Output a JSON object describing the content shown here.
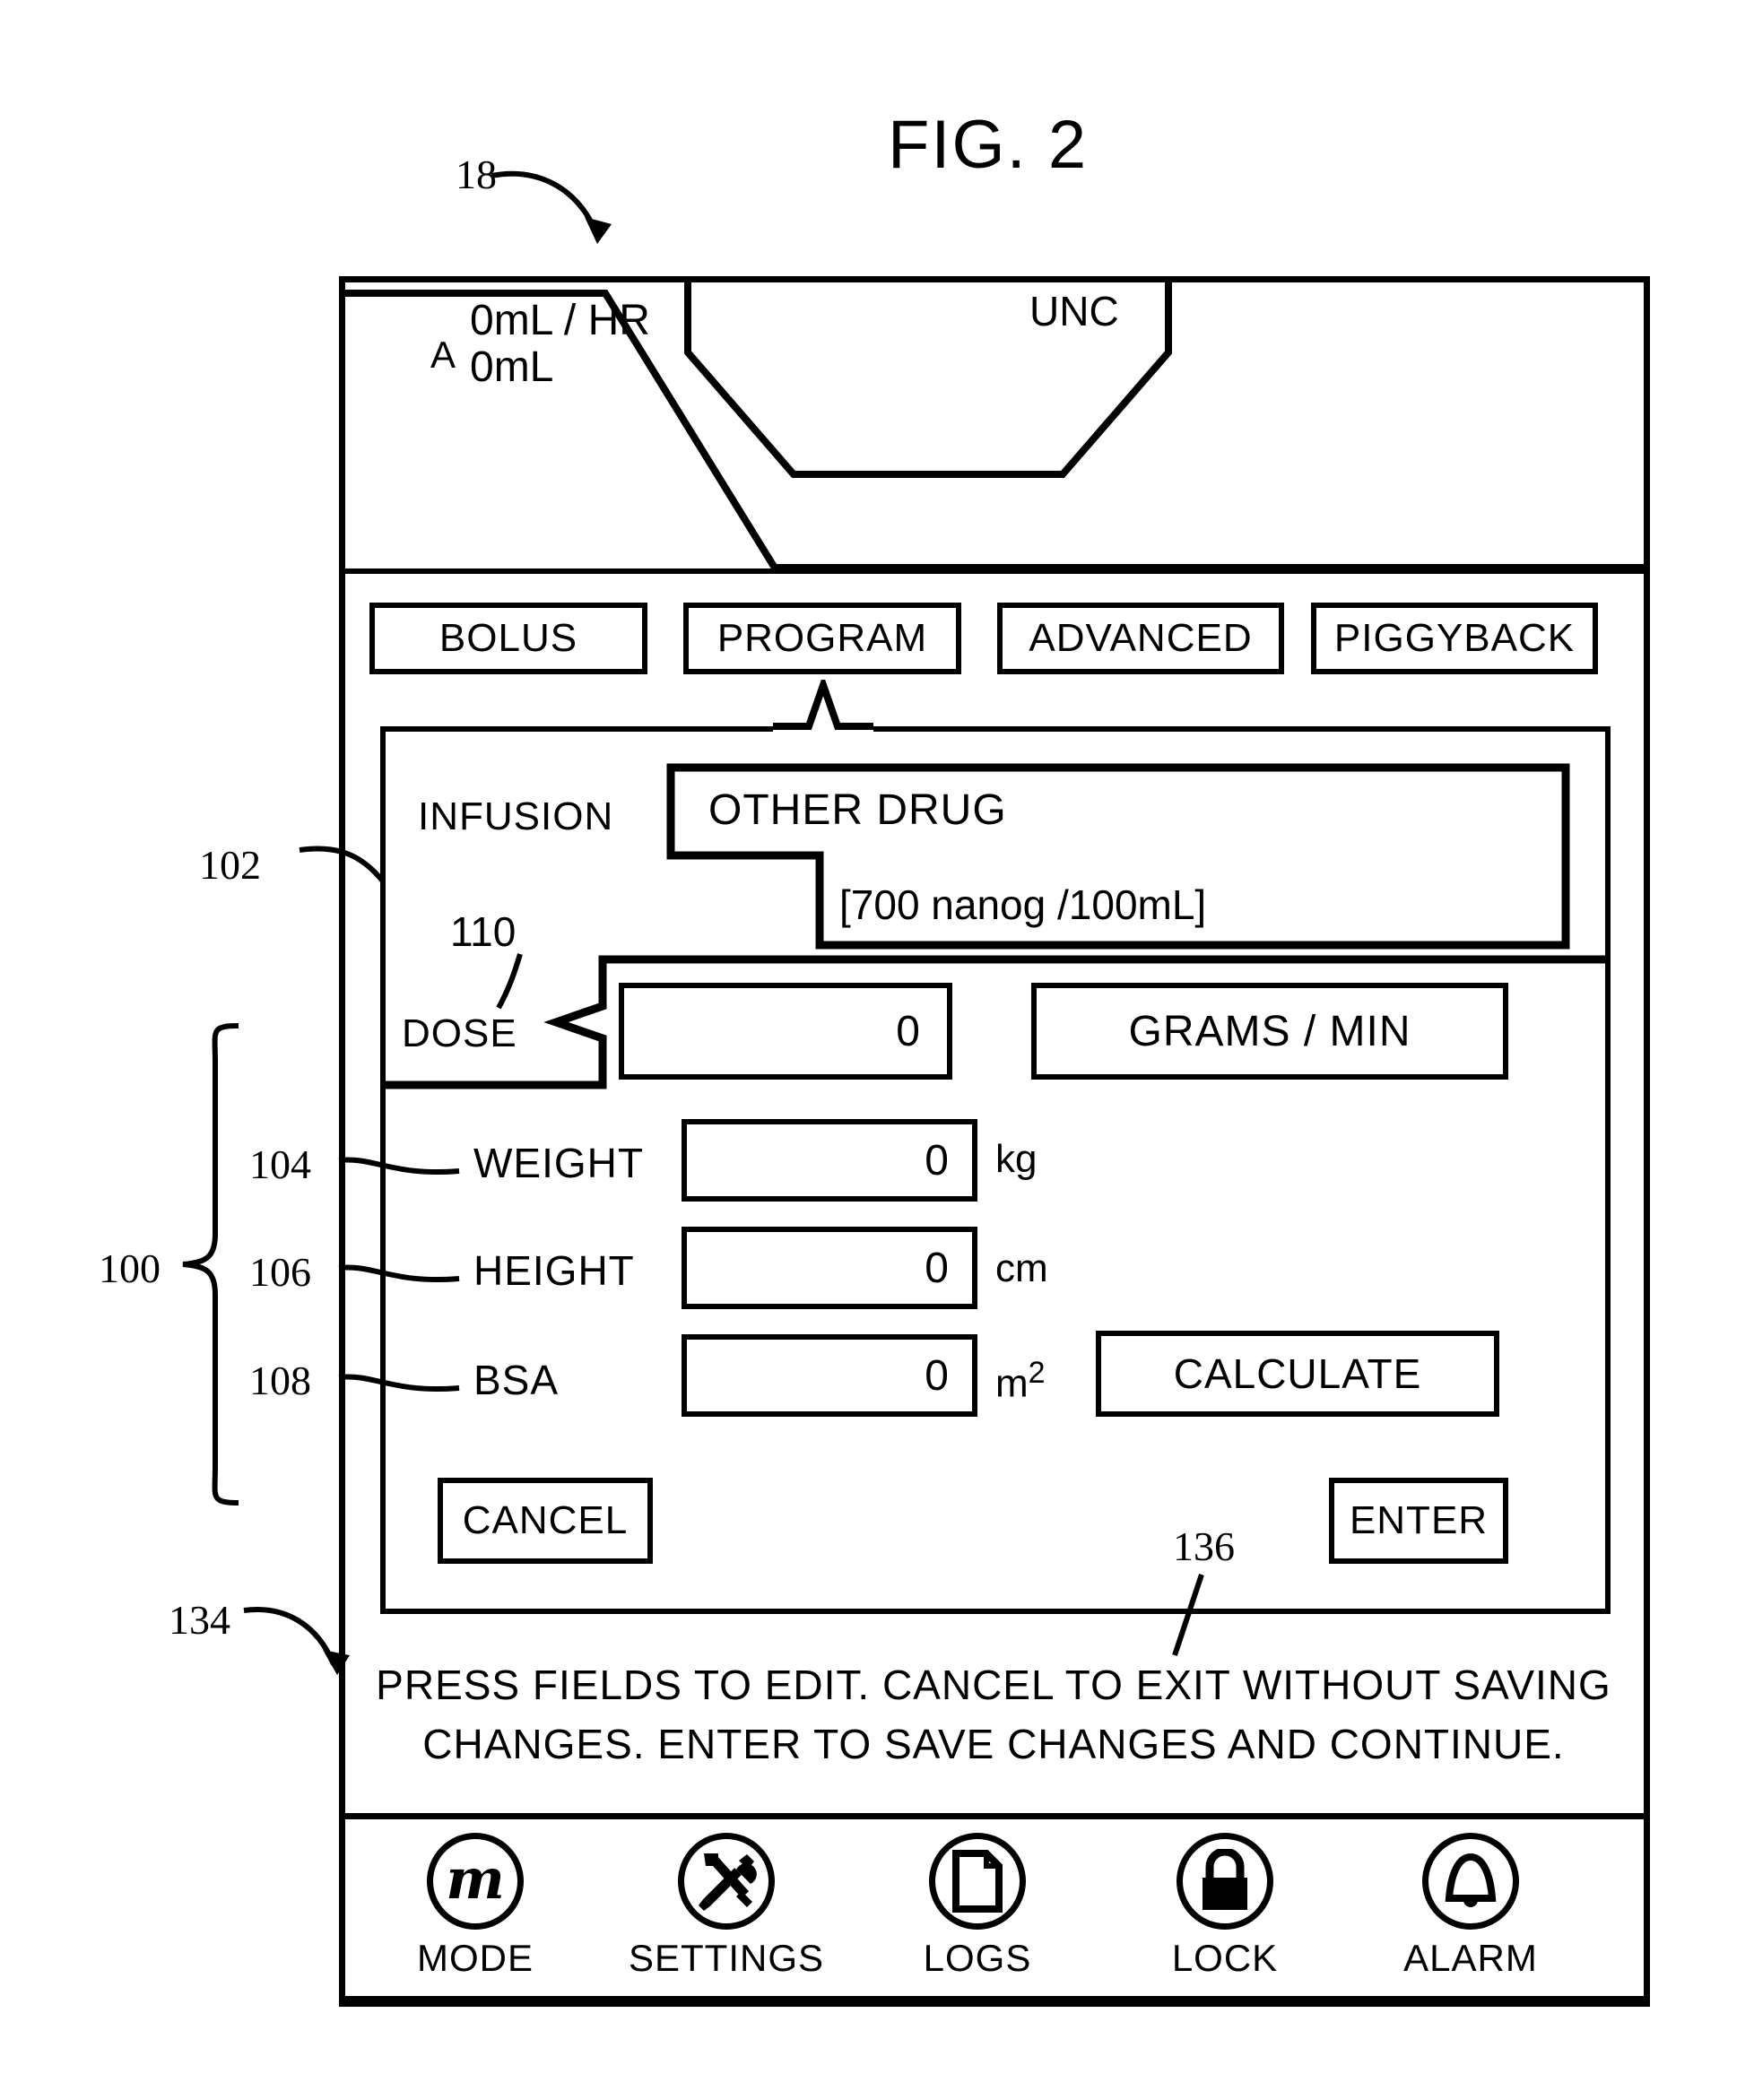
{
  "figure": {
    "title": "FIG. 2",
    "ref_device": "18",
    "ref_panel": "102",
    "ref_dose": "110",
    "ref_group": "100",
    "ref_weight": "104",
    "ref_height": "106",
    "ref_bsa": "108",
    "ref_screen": "134",
    "ref_instruction": "136"
  },
  "header": {
    "channel": "A",
    "rate": "0mL / HR",
    "volume": "0mL",
    "center_label": "UNC"
  },
  "tabs": [
    {
      "label": "BOLUS",
      "selected": false
    },
    {
      "label": "PROGRAM",
      "selected": true
    },
    {
      "label": "ADVANCED",
      "selected": false
    },
    {
      "label": "PIGGYBACK",
      "selected": false
    }
  ],
  "form": {
    "infusion": {
      "label": "INFUSION",
      "drug_name": "OTHER  DRUG",
      "concentration": "[700  nanog /100mL]"
    },
    "dose": {
      "label": "DOSE",
      "value": "0",
      "unit_label": "GRAMS / MIN"
    },
    "params": [
      {
        "label": "WEIGHT",
        "value": "0",
        "unit": "kg",
        "sup": ""
      },
      {
        "label": "HEIGHT",
        "value": "0",
        "unit": "cm",
        "sup": ""
      },
      {
        "label": "BSA",
        "value": "0",
        "unit": "m",
        "sup": "2"
      }
    ],
    "calculate_label": "CALCULATE",
    "cancel_label": "CANCEL",
    "enter_label": "ENTER"
  },
  "instruction": {
    "line1": "PRESS  FIELDS  TO  EDIT. CANCEL  TO  EXIT  WITHOUT  SAVING",
    "line2": "CHANGES. ENTER  TO  SAVE  CHANGES  AND  CONTINUE."
  },
  "navbar": [
    {
      "label": "MODE",
      "icon": "script-m-icon"
    },
    {
      "label": "SETTINGS",
      "icon": "tools-icon"
    },
    {
      "label": "LOGS",
      "icon": "document-icon"
    },
    {
      "label": "LOCK",
      "icon": "padlock-icon"
    },
    {
      "label": "ALARM",
      "icon": "bell-icon"
    }
  ],
  "colors": {
    "ink": "#000000",
    "paper": "#ffffff"
  }
}
